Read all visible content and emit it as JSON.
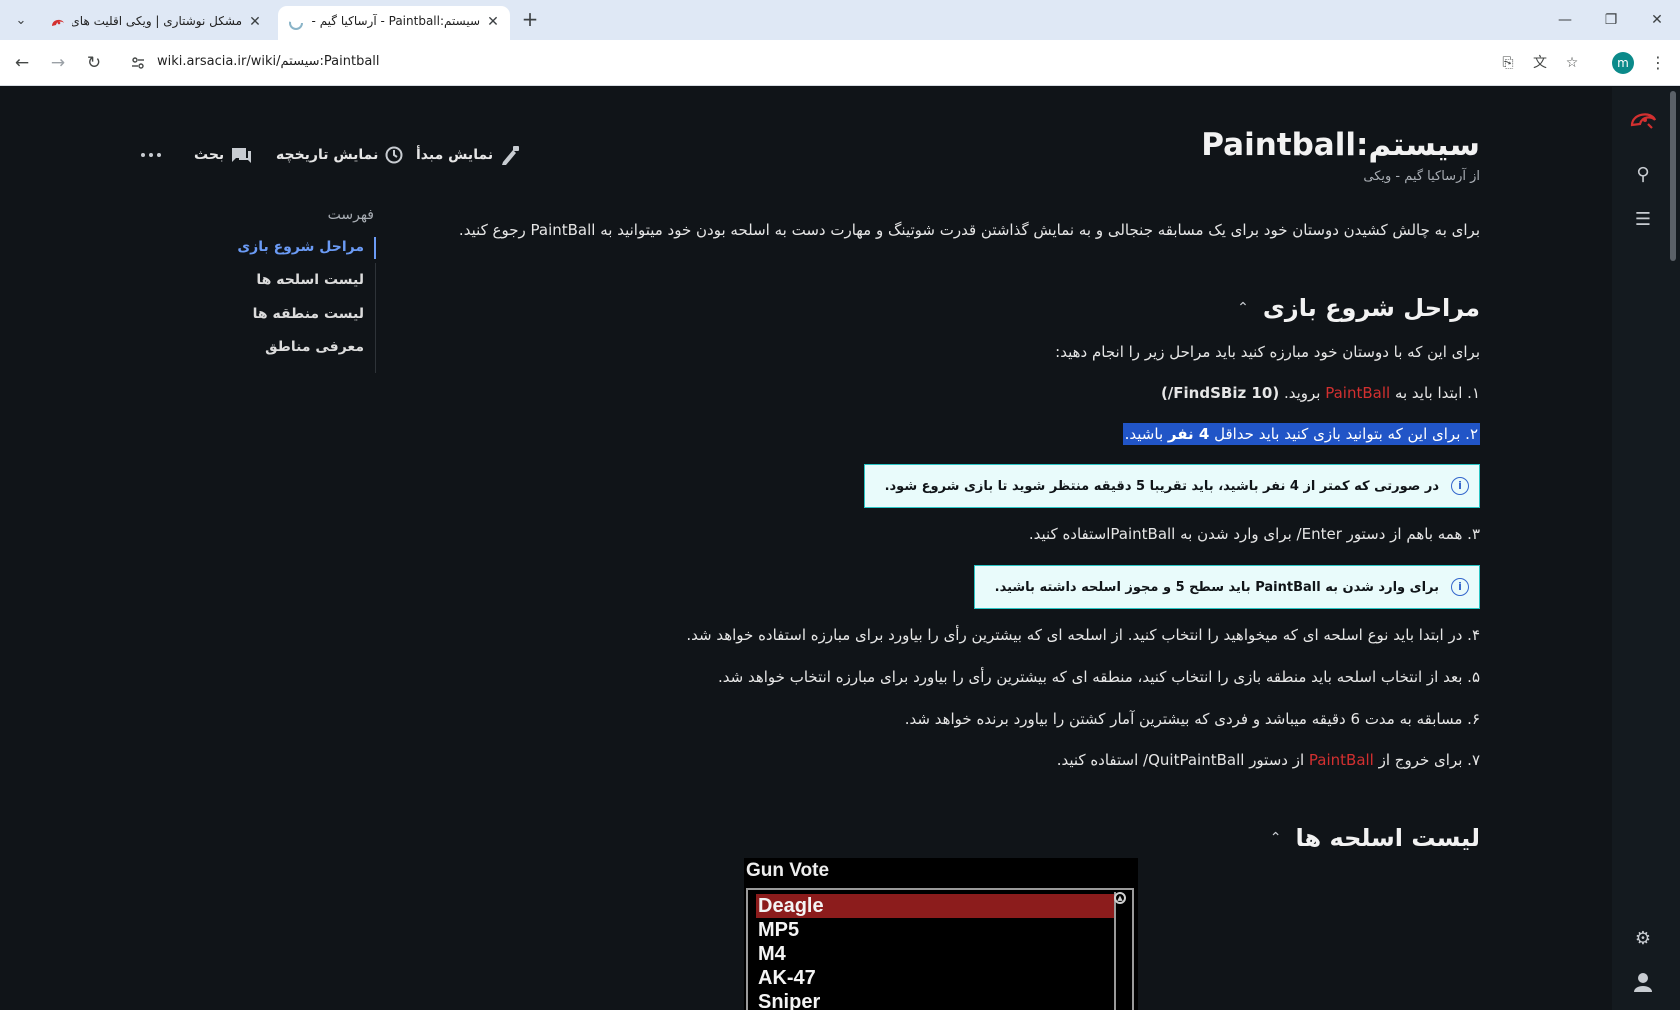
{
  "browser": {
    "tabs": [
      {
        "title": "مشکل نوشتاری | ویکی اقلیت های",
        "active": false
      },
      {
        "title": "سیستم:Paintball - آرساکیا گیم - و",
        "active": true
      }
    ],
    "url": "wiki.arsacia.ir/wiki/سیستم:Paintball",
    "profile_initial": "m"
  },
  "page": {
    "title": "سیستم:Paintball",
    "subtitle": "از آرساکیا گیم - ویکی",
    "actions": {
      "view_source": "نمایش مبدأ",
      "history": "نمایش تاریخچه",
      "talk": "بحث"
    },
    "intro": "برای به چالش کشیدن دوستان خود برای یک مسابقه جنجالی و به نمایش گذاشتن قدرت شوتینگ و مهارت دست به اسلحه بودن خود میتوانید به PaintBall رجوع کنید.",
    "toc": {
      "title": "فهرست",
      "items": [
        "مراحل شروع بازی",
        "لیست اسلحه ها",
        "لیست منطقه ها",
        "معرفی مناطق"
      ]
    },
    "section1": {
      "heading": "مراحل شروع بازی",
      "lead": "برای این که با دوستان خود مبارزه کنید باید مراحل زیر را انجام دهید:",
      "step1": {
        "pre": "۱. ابتدا باید به ",
        "red": "PaintBall",
        "mid": " بروید. ",
        "bold": "(FindSBiz 10/)"
      },
      "step2": {
        "pre": "۲. برای این که بتوانید بازی کنید باید حداقل ",
        "bold": "4 نفر",
        "post": " باشید."
      },
      "note1": "در صورتی که کمتر از 4 نفر باشید، باید تقریبا 5 دقیقه منتظر شوید تا بازی شروع شود.",
      "step3": "۳. همه باهم از دستور Enter/ برای وارد شدن به PaintBallاستفاده کنید.",
      "note2": "برای وارد شدن به PaintBall باید سطح 5 و مجوز اسلحه داشته باشید.",
      "step4": "۴. در ابتدا باید نوع اسلحه ای که میخواهید را انتخاب کنید. از اسلحه ای که بیشترین رأی را بیاورد برای مبارزه استفاده خواهد شد.",
      "step5": "۵. بعد از انتخاب اسلحه باید منطقه بازی را انتخاب کنید، منطقه ای که بیشترین رأی را بیاورد برای مبارزه انتخاب خواهد شد.",
      "step6": "۶. مسابقه به مدت 6 دقیقه میباشد و فردی که بیشترین آمار کشتن را بیاورد برنده خواهد شد.",
      "step7": {
        "pre": "۷. برای خروج از ",
        "red": "PaintBall",
        "post": " از دستور QuitPaintBall/ استفاده کنید."
      }
    },
    "section2": {
      "heading": "لیست اسلحه ها"
    },
    "gun_vote": {
      "title": "Gun Vote",
      "items": [
        "Deagle",
        "MP5",
        "M4",
        "AK-47",
        "Sniper"
      ],
      "selected": "Deagle"
    }
  }
}
